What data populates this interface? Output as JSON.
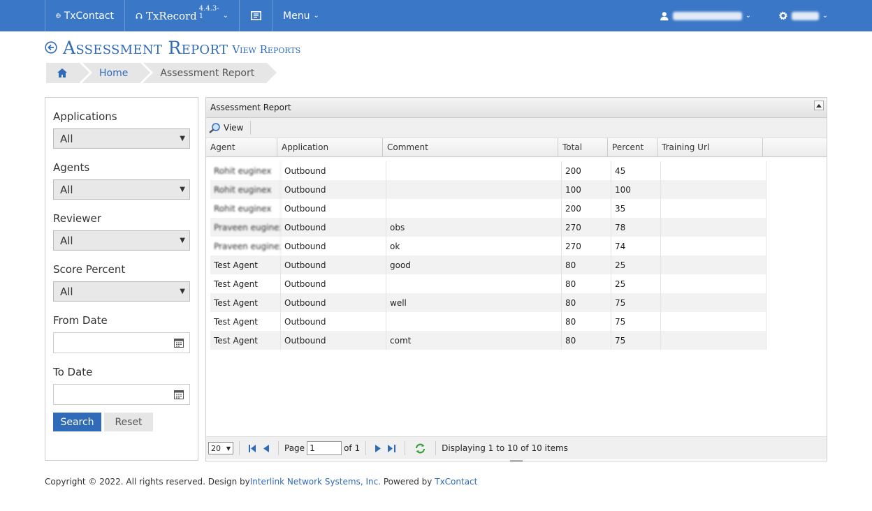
{
  "nav": {
    "txcontact_label": "TxContact",
    "txrecord_label": "TxRecord",
    "txrecord_version": "4.4.3-1",
    "menu_label": "Menu"
  },
  "page": {
    "title": "Assessment Report",
    "subtitle": "View Reports"
  },
  "breadcrumb": {
    "items": [
      "Home",
      "Assessment Report"
    ]
  },
  "filters": {
    "applications_label": "Applications",
    "applications_value": "All",
    "agents_label": "Agents",
    "agents_value": "All",
    "reviewer_label": "Reviewer",
    "reviewer_value": "All",
    "score_label": "Score Percent",
    "score_value": "All",
    "from_date_label": "From Date",
    "to_date_label": "To Date",
    "search_label": "Search",
    "reset_label": "Reset"
  },
  "grid": {
    "title": "Assessment Report",
    "view_label": "View",
    "columns": [
      "Agent",
      "Application",
      "Comment",
      "Total",
      "Percent",
      "Training Url"
    ],
    "rows": [
      {
        "agent": "Rohit euginex",
        "application": "Outbound",
        "comment": "",
        "total": "200",
        "percent": "45",
        "url": ""
      },
      {
        "agent": "Rohit euginex",
        "application": "Outbound",
        "comment": "",
        "total": "100",
        "percent": "100",
        "url": ""
      },
      {
        "agent": "Rohit euginex",
        "application": "Outbound",
        "comment": "",
        "total": "200",
        "percent": "35",
        "url": ""
      },
      {
        "agent": "Praveen euginex",
        "application": "Outbound",
        "comment": "obs",
        "total": "270",
        "percent": "78",
        "url": ""
      },
      {
        "agent": "Praveen euginex",
        "application": "Outbound",
        "comment": "ok",
        "total": "270",
        "percent": "74",
        "url": ""
      },
      {
        "agent": "Test Agent",
        "application": "Outbound",
        "comment": "good",
        "total": "80",
        "percent": "25",
        "url": ""
      },
      {
        "agent": "Test Agent",
        "application": "Outbound",
        "comment": "",
        "total": "80",
        "percent": "25",
        "url": ""
      },
      {
        "agent": "Test Agent",
        "application": "Outbound",
        "comment": "well",
        "total": "80",
        "percent": "75",
        "url": ""
      },
      {
        "agent": "Test Agent",
        "application": "Outbound",
        "comment": "",
        "total": "80",
        "percent": "75",
        "url": ""
      },
      {
        "agent": "Test Agent",
        "application": "Outbound",
        "comment": "comt",
        "total": "80",
        "percent": "75",
        "url": ""
      }
    ],
    "pager": {
      "page_size": "20",
      "page_label": "Page",
      "page_value": "1",
      "of_label": "of 1",
      "status": "Displaying 1 to 10 of 10 items"
    }
  },
  "footer": {
    "copyright": "Copyright © 2022. All rights reserved. Design by",
    "design_link": "Interlink Network Systems, Inc.",
    "powered": "Powered by",
    "powered_link": "TxContact"
  },
  "colors": {
    "navbar": "#3a77c6",
    "accent": "#2f6bb8"
  }
}
